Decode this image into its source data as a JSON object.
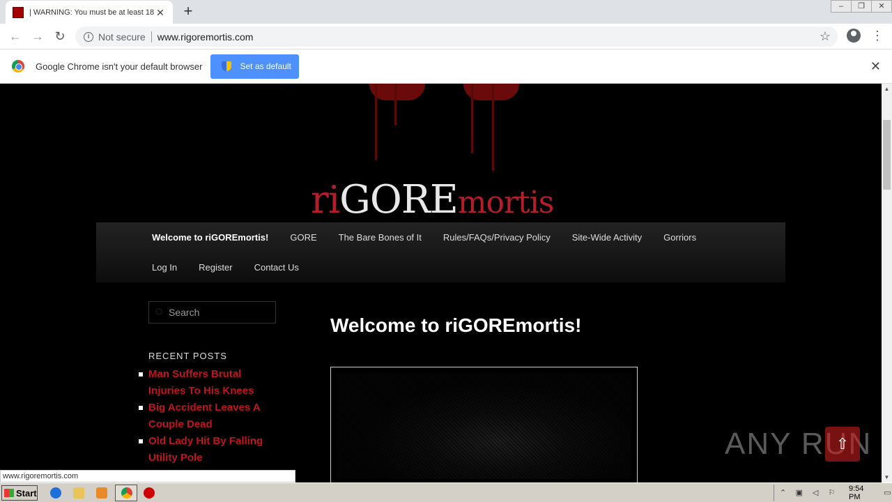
{
  "browser": {
    "tab_title": "| WARNING: You must be at least 18",
    "url": "www.rigoremortis.com",
    "not_secure": "Not secure",
    "new_tab_symbol": "+",
    "window_controls": [
      "–",
      "❐",
      "✕"
    ]
  },
  "infobar": {
    "message": "Google Chrome isn't your default browser",
    "button_label": "Set as default"
  },
  "site": {
    "logo_ri": "ri",
    "logo_gore": "GORE",
    "logo_mortis": "mortis",
    "nav_row1": [
      "Welcome to riGOREmortis!",
      "GORE",
      "The Bare Bones of It",
      "Rules/FAQs/Privacy Policy",
      "Site-Wide Activity",
      "Gorriors"
    ],
    "nav_row2": [
      "Log In",
      "Register",
      "Contact Us"
    ],
    "search_placeholder": "Search",
    "recent_heading": "RECENT POSTS",
    "recent_posts": [
      "Man Suffers Brutal Injuries To His Knees",
      "Big Accident Leaves A Couple Dead",
      "Old Lady Hit By Falling Utility Pole"
    ],
    "post_title": "Welcome to riGOREmortis!"
  },
  "status_url": "www.rigoremortis.com",
  "watermark": "ANY RUN",
  "taskbar": {
    "start_label": "Start",
    "clock": "9:54 PM"
  },
  "icons": {
    "back": "back-arrow-icon",
    "forward": "forward-arrow-icon",
    "reload": "reload-icon",
    "star": "star-icon",
    "account": "account-icon",
    "menu": "menu-icon"
  },
  "colors": {
    "accent_red": "#c0141e",
    "chrome_blue": "#4d90fe",
    "page_bg": "#000000"
  }
}
